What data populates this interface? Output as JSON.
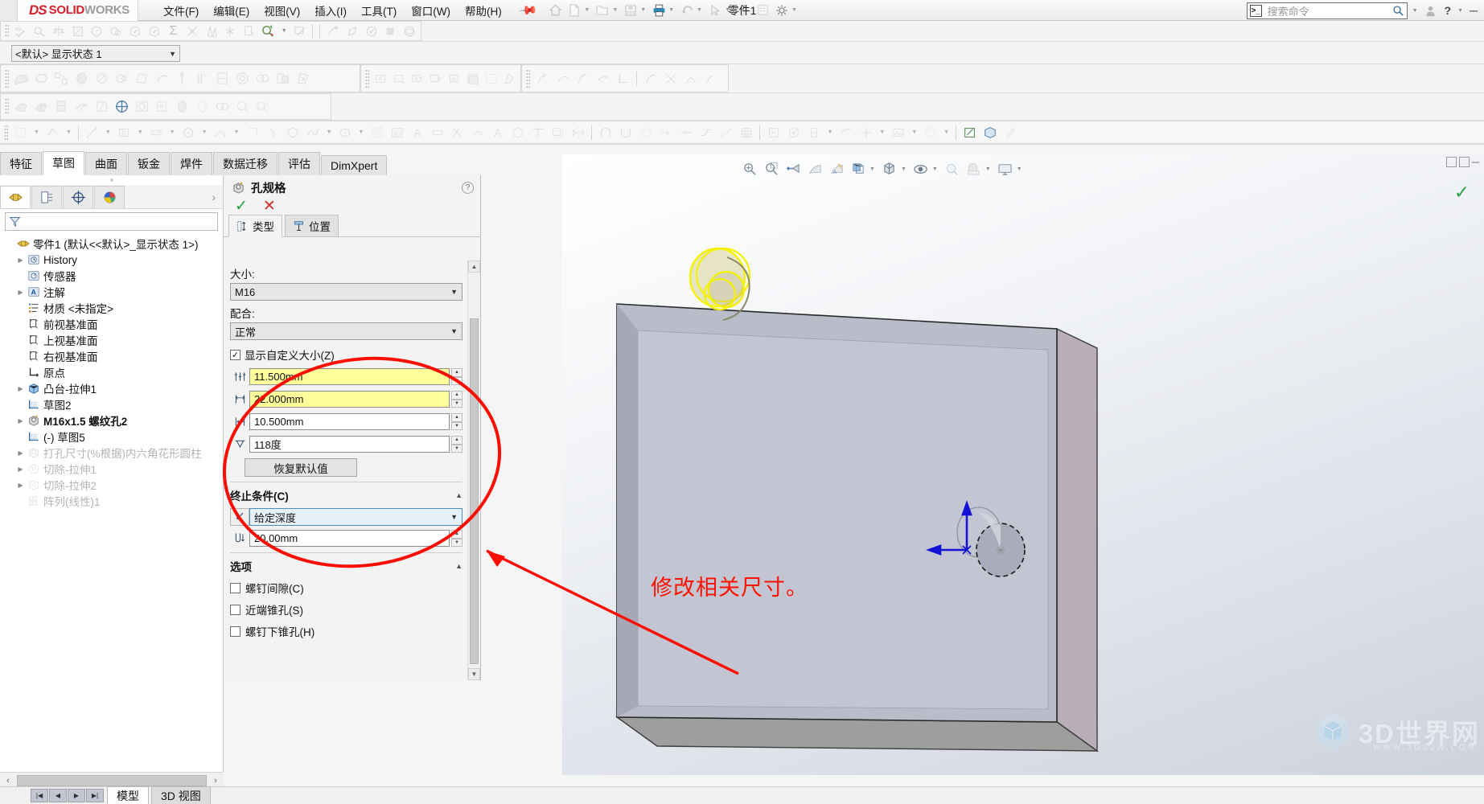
{
  "menubar": {
    "logo": {
      "ds": "DS",
      "solid": "SOLID",
      "works": "WORKS"
    },
    "items": [
      "文件(F)",
      "编辑(E)",
      "视图(V)",
      "插入(I)",
      "工具(T)",
      "窗口(W)",
      "帮助(H)"
    ],
    "pin_icon": "pin-icon",
    "quick_access": [
      "home-icon",
      "new-doc-icon",
      "open-icon",
      "save-icon",
      "print-icon",
      "undo-icon",
      "select-icon",
      "rebuild-icon",
      "file-props-icon",
      "options-icon"
    ],
    "doc_title": "零件1",
    "search": {
      "placeholder": "搜索命令",
      "icon": "search-icon",
      "cmd_icon": "command-prompt-icon"
    },
    "account_icon": "user-icon",
    "help_icon": "help-icon",
    "minimize_icon": "minimize-icon"
  },
  "config_bar": {
    "value": "<默认> 显示状态 1",
    "dropdown_icon": "chevron-down-icon"
  },
  "cad_tabs": [
    {
      "label": "特征",
      "active": false
    },
    {
      "label": "草图",
      "active": true
    },
    {
      "label": "曲面",
      "active": false
    },
    {
      "label": "钣金",
      "active": false
    },
    {
      "label": "焊件",
      "active": false
    },
    {
      "label": "数据迁移",
      "active": false
    },
    {
      "label": "评估",
      "active": false
    },
    {
      "label": "DimXpert",
      "active": false
    }
  ],
  "tree_panel": {
    "tabs": [
      "feature-manager-icon",
      "property-manager-icon",
      "configuration-manager-icon",
      "display-manager-icon"
    ],
    "expand_icon": "chevron-right-icon",
    "filter_icon": "filter-icon",
    "root": "零件1  (默认<<默认>_显示状态 1>)",
    "items": [
      {
        "label": "History",
        "icon": "history-icon",
        "arrow": true,
        "dim": false,
        "indent": 1
      },
      {
        "label": "传感器",
        "icon": "sensor-icon",
        "arrow": false,
        "dim": false,
        "indent": 1
      },
      {
        "label": "注解",
        "icon": "annotation-icon",
        "arrow": true,
        "dim": false,
        "indent": 1
      },
      {
        "label": "材质 <未指定>",
        "icon": "material-icon",
        "arrow": false,
        "dim": false,
        "indent": 1
      },
      {
        "label": "前视基准面",
        "icon": "plane-icon",
        "arrow": false,
        "dim": false,
        "indent": 1
      },
      {
        "label": "上视基准面",
        "icon": "plane-icon",
        "arrow": false,
        "dim": false,
        "indent": 1
      },
      {
        "label": "右视基准面",
        "icon": "plane-icon",
        "arrow": false,
        "dim": false,
        "indent": 1
      },
      {
        "label": "原点",
        "icon": "origin-icon",
        "arrow": false,
        "dim": false,
        "indent": 1
      },
      {
        "label": "凸台-拉伸1",
        "icon": "boss-extrude-icon",
        "arrow": true,
        "dim": false,
        "indent": 1
      },
      {
        "label": "草图2",
        "icon": "sketch-icon",
        "arrow": false,
        "dim": false,
        "indent": 1
      },
      {
        "label": "M16x1.5 螺纹孔2",
        "icon": "hole-wizard-icon",
        "arrow": true,
        "dim": false,
        "indent": 1
      },
      {
        "label": "(-) 草图5",
        "icon": "sketch-icon",
        "arrow": false,
        "dim": false,
        "indent": 1
      },
      {
        "label": "打孔尺寸(%根据)内六角花形圆柱",
        "icon": "hole-wizard-icon",
        "arrow": true,
        "dim": true,
        "indent": 1
      },
      {
        "label": "切除-拉伸1",
        "icon": "cut-extrude-icon",
        "arrow": true,
        "dim": true,
        "indent": 1
      },
      {
        "label": "切除-拉伸2",
        "icon": "cut-extrude-icon",
        "arrow": true,
        "dim": true,
        "indent": 1
      },
      {
        "label": "阵列(线性)1",
        "icon": "linear-pattern-icon",
        "arrow": false,
        "dim": true,
        "indent": 1
      }
    ]
  },
  "property_manager": {
    "icon": "hole-wizard-icon",
    "title": "孔规格",
    "help_icon": "help-icon",
    "ok_icon": "checkmark-icon",
    "cancel_icon": "cancel-icon",
    "tabs": [
      {
        "label": "类型",
        "icon": "hole-type-icon",
        "active": true
      },
      {
        "label": "位置",
        "icon": "hole-position-icon",
        "active": false
      }
    ],
    "size_label": "大小:",
    "size_value": "M16",
    "fit_label": "配合:",
    "fit_value": "正常",
    "show_custom_label": "显示自定义大小(Z)",
    "show_custom_checked": true,
    "custom_fields": [
      {
        "icon": "thread-diameter-icon",
        "value": "11.500mm",
        "highlighted": true
      },
      {
        "icon": "hole-depth-icon",
        "value": "22.000mm",
        "highlighted": true
      },
      {
        "icon": "thread-offset-icon",
        "value": "10.500mm",
        "highlighted": false
      },
      {
        "icon": "drill-angle-icon",
        "value": "118度",
        "highlighted": false
      }
    ],
    "restore_defaults": "恢复默认值",
    "end_condition_header": "终止条件(C)",
    "end_condition_icon": "end-condition-icon",
    "end_condition_value": "给定深度",
    "depth_icon": "depth-icon",
    "depth_value": "20.00mm",
    "options_header": "选项",
    "options": [
      {
        "label": "螺钉间隙(C)",
        "checked": false
      },
      {
        "label": "近端锥孔(S)",
        "checked": false
      },
      {
        "label": "螺钉下锥孔(H)",
        "checked": false
      }
    ],
    "collapse_icon": "chevron-up-icon",
    "scroll_up_icon": "scroll-up-icon",
    "scroll_down_icon": "scroll-down-icon"
  },
  "viewport": {
    "toolbar": [
      "zoom-to-fit-icon",
      "zoom-to-area-icon",
      "previous-view-icon",
      "section-view-icon",
      "view-orientation-icon",
      "display-style-icon",
      "hide-show-icon",
      "edit-appearance-icon",
      "apply-scene-icon",
      "view-settings-icon"
    ],
    "confirm_icon": "confirm-checkmark-icon",
    "annotation_text": "修改相关尺寸。",
    "highlight_ellipse": "red-ellipse-annotation",
    "arrow": "red-arrow-annotation",
    "triad": {
      "x_axis": "x-axis-arrow",
      "y_axis": "y-axis-arrow",
      "origin": "origin-marker"
    }
  },
  "watermark": {
    "text": "3D世界网",
    "url": "WWW.3DSJW.COM",
    "icon": "cube-logo-icon"
  },
  "statusbar": {
    "nav_buttons": [
      "first-icon",
      "previous-icon",
      "next-icon",
      "last-icon"
    ],
    "tabs": [
      {
        "label": "模型",
        "active": true
      },
      {
        "label": "3D 视图",
        "active": false
      }
    ],
    "hscroll": {
      "left_icon": "chevron-left-icon",
      "right_icon": "chevron-right-icon"
    }
  }
}
